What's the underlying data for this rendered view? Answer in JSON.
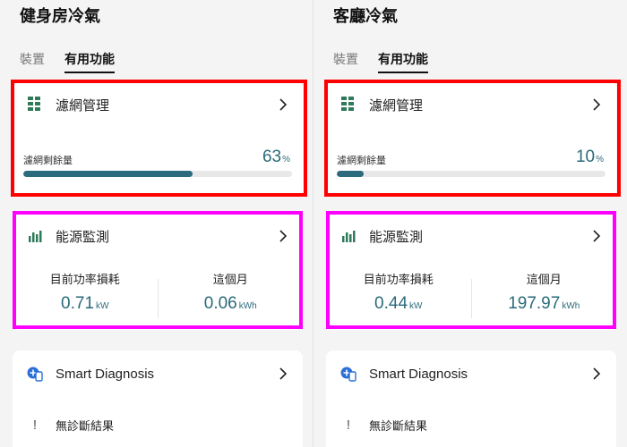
{
  "colors": {
    "accent": "#2c6a7e",
    "highlight_filter": "#ff0000",
    "highlight_energy": "#ff00ff"
  },
  "panels": [
    {
      "room_title": "健身房冷氣",
      "tabs": [
        {
          "label": "裝置"
        },
        {
          "label": "有用功能"
        }
      ],
      "filter": {
        "title": "濾網管理",
        "icon": "filter-grid-icon",
        "remaining_label": "濾網剩餘量",
        "remaining_value": "63",
        "remaining_unit": "%",
        "remaining_fraction": 0.63
      },
      "energy": {
        "title": "能源監測",
        "icon": "bar-chart-icon",
        "current_label": "目前功率損耗",
        "current_value": "0.71",
        "current_unit": "kW",
        "month_label": "這個月",
        "month_value": "0.06",
        "month_unit": "kWh"
      },
      "diagnosis": {
        "title": "Smart Diagnosis",
        "icon": "smart-diagnosis-icon",
        "result_text": "無診斷結果",
        "result_icon": "exclamation-icon",
        "result_glyph": "!"
      }
    },
    {
      "room_title": "客廳冷氣",
      "tabs": [
        {
          "label": "裝置"
        },
        {
          "label": "有用功能"
        }
      ],
      "filter": {
        "title": "濾網管理",
        "icon": "filter-grid-icon",
        "remaining_label": "濾網剩餘量",
        "remaining_value": "10",
        "remaining_unit": "%",
        "remaining_fraction": 0.1
      },
      "energy": {
        "title": "能源監測",
        "icon": "bar-chart-icon",
        "current_label": "目前功率損耗",
        "current_value": "0.44",
        "current_unit": "kW",
        "month_label": "這個月",
        "month_value": "197.97",
        "month_unit": "kWh"
      },
      "diagnosis": {
        "title": "Smart Diagnosis",
        "icon": "smart-diagnosis-icon",
        "result_text": "無診斷結果",
        "result_icon": "exclamation-icon",
        "result_glyph": "!"
      }
    }
  ]
}
